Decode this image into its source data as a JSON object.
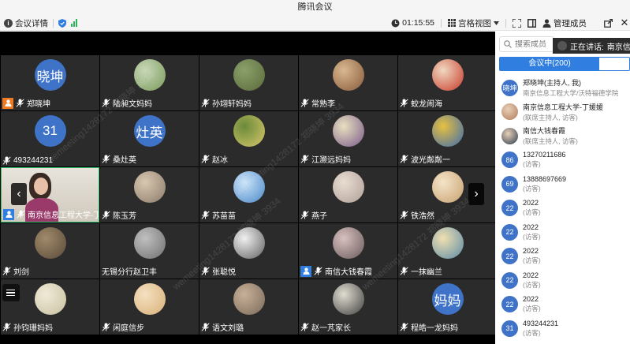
{
  "app": {
    "title": "腾讯会议"
  },
  "toolbar": {
    "meeting_details": "会议详情",
    "timer": "01:15:55",
    "view_mode": "宫格视图",
    "manage_members": "管理成员"
  },
  "grid": {
    "tiles": [
      {
        "name": "郑晓坤",
        "avatar_text": "晓坤",
        "host": "orange"
      },
      {
        "name": "陆昶文妈妈",
        "avatar_text": ""
      },
      {
        "name": "孙翊轩妈妈",
        "avatar_text": ""
      },
      {
        "name": "常熟李",
        "avatar_text": ""
      },
      {
        "name": "蛟龙闹海",
        "avatar_text": ""
      },
      {
        "name": "493244231",
        "avatar_text": "31"
      },
      {
        "name": "桑灶英",
        "avatar_text": "灶英"
      },
      {
        "name": "赵冰",
        "avatar_text": ""
      },
      {
        "name": "江灏远妈妈",
        "avatar_text": ""
      },
      {
        "name": "波光粼粼一",
        "avatar_text": ""
      },
      {
        "name": "南京信息工程大学-丁...",
        "avatar_text": "",
        "host": "blue",
        "speaker": true
      },
      {
        "name": "陈玉芳",
        "avatar_text": ""
      },
      {
        "name": "苏苗苗",
        "avatar_text": ""
      },
      {
        "name": "燕子",
        "avatar_text": ""
      },
      {
        "name": "铁浩然",
        "avatar_text": ""
      },
      {
        "name": "刘剑",
        "avatar_text": ""
      },
      {
        "name": "无锡分行赵卫丰",
        "avatar_text": "",
        "nomic": true
      },
      {
        "name": "张聪悦",
        "avatar_text": ""
      },
      {
        "name": "南信大钱春霞",
        "avatar_text": "",
        "host": "blue"
      },
      {
        "name": "一抹幽兰",
        "avatar_text": ""
      },
      {
        "name": "孙钧珊妈妈",
        "avatar_text": ""
      },
      {
        "name": "闲庭信步",
        "avatar_text": ""
      },
      {
        "name": "语文刘璐",
        "avatar_text": ""
      },
      {
        "name": "赵一芃家长",
        "avatar_text": ""
      },
      {
        "name": "程皓一龙妈妈",
        "avatar_text": "妈妈"
      }
    ],
    "watermark": "wemeeting1428172 郑晓坤 3934"
  },
  "sidebar": {
    "search_placeholder": "搜索成员",
    "speaking_label": "正在讲话:",
    "speaking_name": "南京信",
    "tab_active": "会议中(200)",
    "members": [
      {
        "name": "郑晓坤(主持人, 我)",
        "sub": "南京信息工程大学/沃特福德学院",
        "avatar_text": "晓坤"
      },
      {
        "name": "南京信息工程大学-丁媛媛",
        "sub": "(联席主持人, 访客)",
        "avatar_text": ""
      },
      {
        "name": "南信大钱春霞",
        "sub": "(联席主持人, 访客)",
        "avatar_text": ""
      },
      {
        "name": "13270211686",
        "sub": "(访客)",
        "avatar_text": "86"
      },
      {
        "name": "13888697669",
        "sub": "(访客)",
        "avatar_text": "69"
      },
      {
        "name": "2022",
        "sub": "(访客)",
        "avatar_text": "22"
      },
      {
        "name": "2022",
        "sub": "(访客)",
        "avatar_text": "22"
      },
      {
        "name": "2022",
        "sub": "(访客)",
        "avatar_text": "22"
      },
      {
        "name": "2022",
        "sub": "(访客)",
        "avatar_text": "22"
      },
      {
        "name": "2022",
        "sub": "(访客)",
        "avatar_text": "22"
      },
      {
        "name": "493244231",
        "sub": "(访客)",
        "avatar_text": "31"
      }
    ]
  },
  "colors": {
    "accent": "#2f7ee0",
    "speaker_border": "#2fc26b",
    "avatar_blue": "#3f73c8",
    "host_orange": "#f07a22"
  }
}
